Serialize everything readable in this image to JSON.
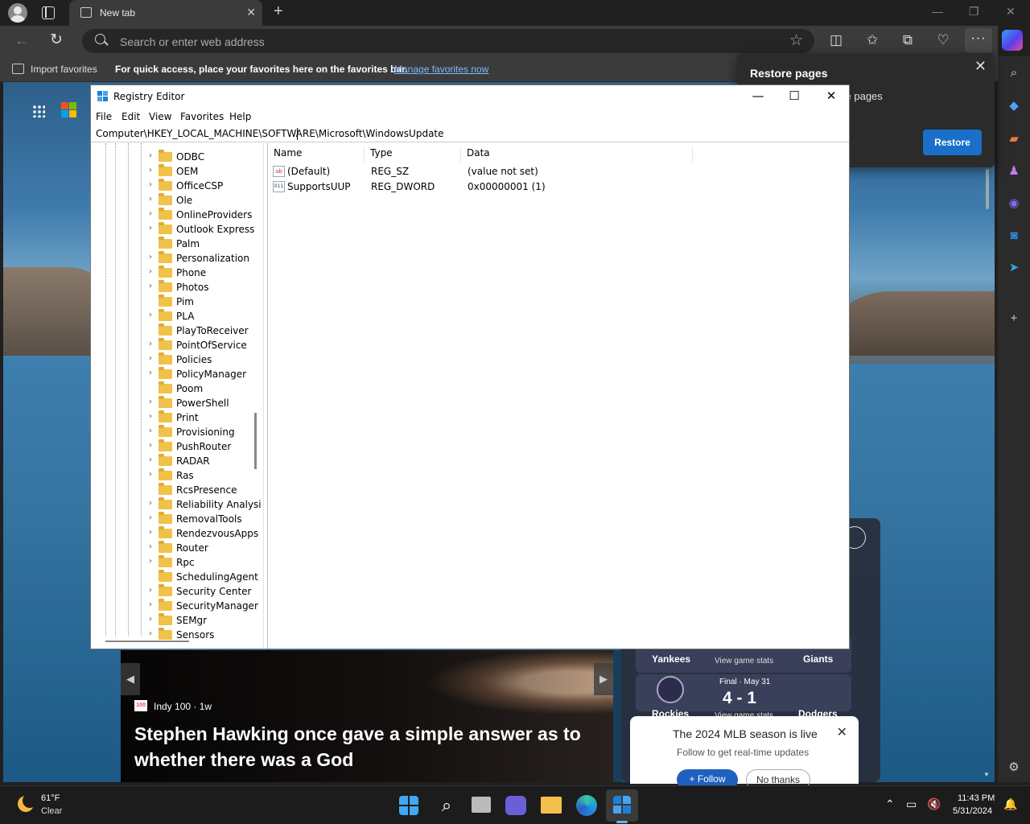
{
  "browser": {
    "tab_title": "New tab",
    "address_placeholder": "Search or enter web address",
    "favorites_bar": {
      "import_label": "Import favorites",
      "message": "For quick access, place your favorites here on the favorites bar.",
      "link": "Manage favorites now"
    }
  },
  "restore_popup": {
    "title": "Restore pages",
    "message": "d while you had some pages",
    "button": "Restore"
  },
  "registry_editor": {
    "title": "Registry Editor",
    "menu": [
      "File",
      "Edit",
      "View",
      "Favorites",
      "Help"
    ],
    "path": "Computer\\HKEY_LOCAL_MACHINE\\SOFTWARE\\Microsoft\\WindowsUpdate",
    "tree": [
      {
        "label": "ODBC",
        "expandable": true
      },
      {
        "label": "OEM",
        "expandable": true
      },
      {
        "label": "OfficeCSP",
        "expandable": true
      },
      {
        "label": "Ole",
        "expandable": true
      },
      {
        "label": "OnlineProviders",
        "expandable": true
      },
      {
        "label": "Outlook Express",
        "expandable": true
      },
      {
        "label": "Palm",
        "expandable": false
      },
      {
        "label": "Personalization",
        "expandable": true
      },
      {
        "label": "Phone",
        "expandable": true
      },
      {
        "label": "Photos",
        "expandable": true
      },
      {
        "label": "Pim",
        "expandable": false
      },
      {
        "label": "PLA",
        "expandable": true
      },
      {
        "label": "PlayToReceiver",
        "expandable": false
      },
      {
        "label": "PointOfService",
        "expandable": true
      },
      {
        "label": "Policies",
        "expandable": true
      },
      {
        "label": "PolicyManager",
        "expandable": true
      },
      {
        "label": "Poom",
        "expandable": false
      },
      {
        "label": "PowerShell",
        "expandable": true
      },
      {
        "label": "Print",
        "expandable": true
      },
      {
        "label": "Provisioning",
        "expandable": true
      },
      {
        "label": "PushRouter",
        "expandable": true
      },
      {
        "label": "RADAR",
        "expandable": true
      },
      {
        "label": "Ras",
        "expandable": true
      },
      {
        "label": "RcsPresence",
        "expandable": false
      },
      {
        "label": "Reliability Analysi",
        "expandable": true
      },
      {
        "label": "RemovalTools",
        "expandable": true
      },
      {
        "label": "RendezvousApps",
        "expandable": true
      },
      {
        "label": "Router",
        "expandable": true
      },
      {
        "label": "Rpc",
        "expandable": true
      },
      {
        "label": "SchedulingAgent",
        "expandable": false
      },
      {
        "label": "Security Center",
        "expandable": true
      },
      {
        "label": "SecurityManager",
        "expandable": true
      },
      {
        "label": "SEMgr",
        "expandable": true
      },
      {
        "label": "Sensors",
        "expandable": true
      }
    ],
    "columns": [
      "Name",
      "Type",
      "Data"
    ],
    "values": [
      {
        "name": "(Default)",
        "type": "REG_SZ",
        "data": "(value not set)",
        "icon": "string-value-icon",
        "badge": "ab"
      },
      {
        "name": "SupportsUUP",
        "type": "REG_DWORD",
        "data": "0x00000001 (1)",
        "icon": "binary-value-icon",
        "badge": "011"
      }
    ]
  },
  "news_card": {
    "source": "Indy 100 · 1w",
    "source_badge": "100",
    "headline": "Stephen Hawking once gave a simple answer as to whether there was a God"
  },
  "sports_card": {
    "game1": {
      "home": "Yankees",
      "stats": "View game stats",
      "away": "Giants"
    },
    "game2": {
      "status": "Final · May 31",
      "score": "4 - 1",
      "home": "Rockies",
      "stats": "View game stats",
      "away": "Dodgers"
    }
  },
  "mlb_popup": {
    "title": "The 2024 MLB season is live",
    "subtitle": "Follow to get real-time updates",
    "follow": "+ Follow",
    "dismiss": "No thanks"
  },
  "taskbar": {
    "weather_temp": "61°F",
    "weather_desc": "Clear",
    "time": "11:43 PM",
    "date": "5/31/2024"
  }
}
